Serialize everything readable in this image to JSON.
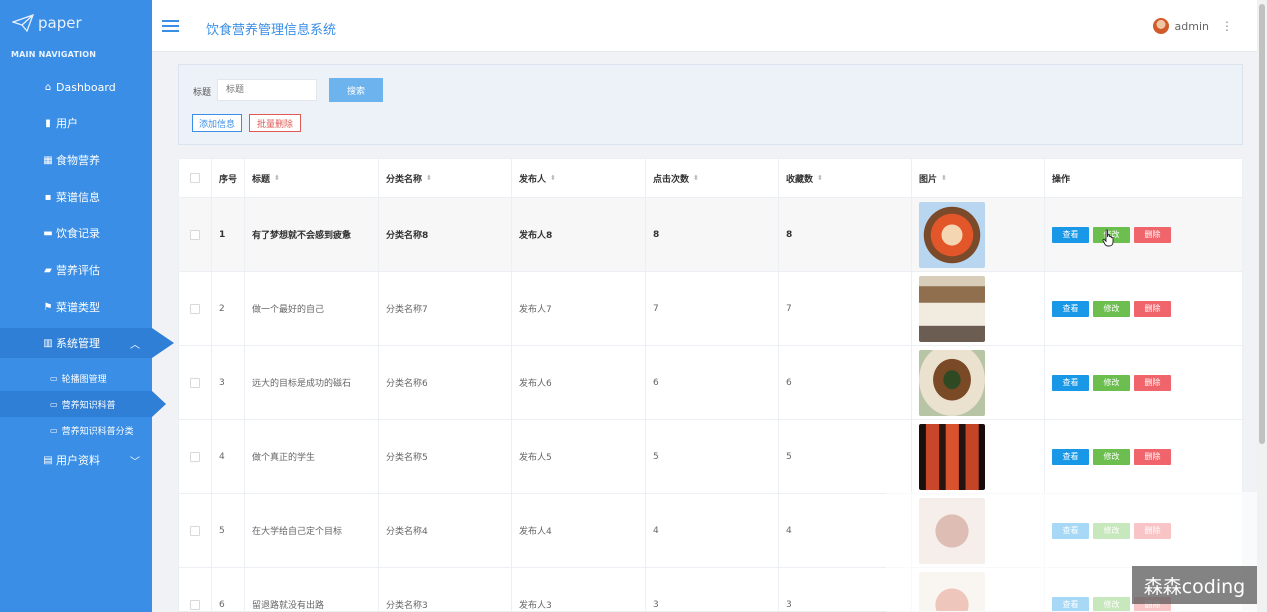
{
  "brand": {
    "name": "paper",
    "icon": "paper-plane-icon"
  },
  "sidebar": {
    "header": "MAIN NAVIGATION",
    "items": [
      {
        "label": "Dashboard",
        "icon": "home-icon"
      },
      {
        "label": "用户",
        "icon": "user-icon"
      },
      {
        "label": "食物营养",
        "icon": "grid-icon"
      },
      {
        "label": "菜谱信息",
        "icon": "apps-icon"
      },
      {
        "label": "饮食记录",
        "icon": "card-icon"
      },
      {
        "label": "营养评估",
        "icon": "chat-icon"
      },
      {
        "label": "菜谱类型",
        "icon": "flag-icon"
      },
      {
        "label": "系统管理",
        "icon": "bar-chart-icon",
        "expanded": true
      },
      {
        "label": "用户资料",
        "icon": "profile-icon"
      }
    ],
    "subitems": [
      {
        "label": "轮播图管理",
        "icon": "folder-icon"
      },
      {
        "label": "营养知识科普",
        "icon": "folder-icon",
        "active": true
      },
      {
        "label": "营养知识科普分类",
        "icon": "folder-icon"
      }
    ]
  },
  "header": {
    "title": "饮食营养管理信息系统",
    "user": "admin"
  },
  "search": {
    "label": "标题",
    "placeholder": "标题",
    "button": "搜索",
    "add": "添加信息",
    "batch_delete": "批量删除"
  },
  "table": {
    "columns": [
      "序号",
      "标题",
      "分类名称",
      "发布人",
      "点击次数",
      "收藏数",
      "图片",
      "操作"
    ],
    "actions": {
      "view": "查看",
      "edit": "修改",
      "delete": "删除"
    },
    "rows": [
      {
        "no": "1",
        "title": "有了梦想就不会感到疲惫",
        "category": "分类名称8",
        "publisher": "发布人8",
        "clicks": "8",
        "favorites": "8"
      },
      {
        "no": "2",
        "title": "做一个最好的自己",
        "category": "分类名称7",
        "publisher": "发布人7",
        "clicks": "7",
        "favorites": "7"
      },
      {
        "no": "3",
        "title": "远大的目标是成功的磁石",
        "category": "分类名称6",
        "publisher": "发布人6",
        "clicks": "6",
        "favorites": "6"
      },
      {
        "no": "4",
        "title": "做个真正的学生",
        "category": "分类名称5",
        "publisher": "发布人5",
        "clicks": "5",
        "favorites": "5"
      },
      {
        "no": "5",
        "title": "在大学给自己定个目标",
        "category": "分类名称4",
        "publisher": "发布人4",
        "clicks": "4",
        "favorites": "4"
      },
      {
        "no": "6",
        "title": "留退路就没有出路",
        "category": "分类名称3",
        "publisher": "发布人3",
        "clicks": "3",
        "favorites": "3"
      }
    ]
  },
  "watermark": "森森coding",
  "colors": {
    "sidebar": "#3a8ee6",
    "primary": "#3a8ee6",
    "danger": "#e05a55",
    "view": "#1a98e8",
    "edit": "#6cbf4f",
    "remove": "#f0656b"
  }
}
